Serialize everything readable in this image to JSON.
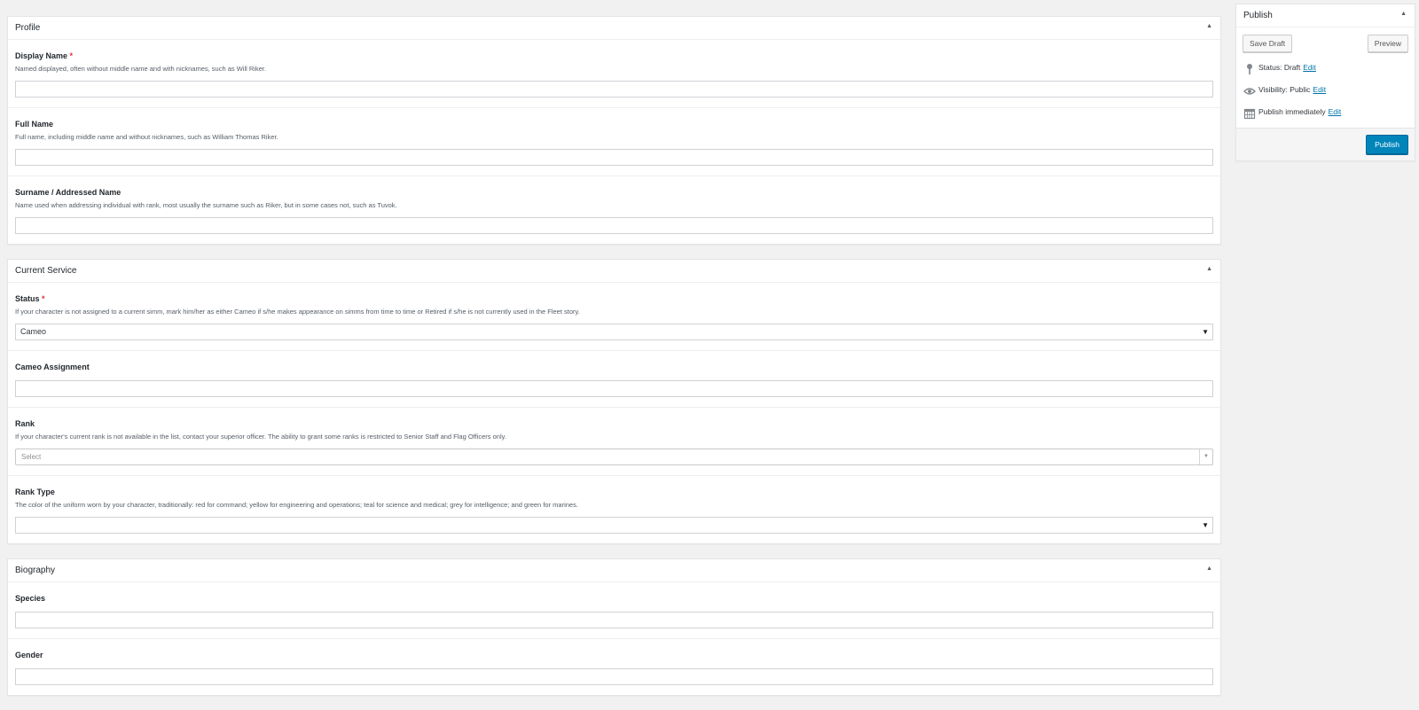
{
  "profile": {
    "title": "Profile",
    "display_name": {
      "label": "Display Name",
      "required": "*",
      "desc": "Named displayed, often without middle name and with nicknames, such as Will Riker.",
      "value": ""
    },
    "full_name": {
      "label": "Full Name",
      "desc": "Full name, including middle name and without nicknames, such as William Thomas Riker.",
      "value": ""
    },
    "surname": {
      "label": "Surname / Addressed Name",
      "desc": "Name used when addressing individual with rank, most usually the surname such as Riker, but in some cases not, such as Tuvok.",
      "value": ""
    }
  },
  "service": {
    "title": "Current Service",
    "status": {
      "label": "Status",
      "required": "*",
      "desc": "If your character is not assigned to a current simm, mark him/her as either Cameo if s/he makes appearance on simms from time to time or Retired if s/he is not currently used in the Fleet story.",
      "value": "Cameo"
    },
    "cameo": {
      "label": "Cameo Assignment",
      "value": ""
    },
    "rank": {
      "label": "Rank",
      "desc": "If your character's current rank is not available in the list, contact your superior officer. The ability to grant some ranks is restricted to Senior Staff and Flag Officers only.",
      "placeholder": "Select"
    },
    "rank_type": {
      "label": "Rank Type",
      "desc": "The color of the uniform worn by your character, traditionally: red for command; yellow for engineering and operations; teal for science and medical; grey for intelligence; and green for marines.",
      "value": ""
    }
  },
  "biography": {
    "title": "Biography",
    "species": {
      "label": "Species",
      "value": ""
    },
    "gender": {
      "label": "Gender",
      "value": ""
    }
  },
  "publish": {
    "title": "Publish",
    "save_draft": "Save Draft",
    "preview": "Preview",
    "status_text": "Status: Draft",
    "visibility_text": "Visibility: Public",
    "schedule_text": "Publish immediately",
    "edit": "Edit",
    "publish_button": "Publish"
  },
  "icons": {
    "toggle": "arrow-up-icon",
    "status": "pin-icon",
    "visibility": "eye-icon",
    "schedule": "calendar-icon"
  },
  "colors": {
    "accent": "#0085ba",
    "link": "#0073aa",
    "required": "#dc3232",
    "background": "#f1f1f1"
  }
}
